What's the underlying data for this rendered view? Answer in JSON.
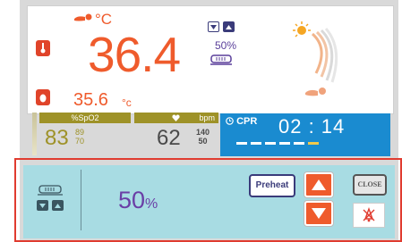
{
  "display": {
    "air_temp": "36.4",
    "air_temp_unit": "°C",
    "skin_temp": "35.6",
    "skin_temp_unit": "°c",
    "heater_top_pct": "50%"
  },
  "vitals": {
    "spo2_label": "%SpO2",
    "spo2_value": "83",
    "spo2_high": "89",
    "spo2_low": "70",
    "hr_unit": "bpm",
    "hr_value": "62",
    "hr_high": "140",
    "hr_low": "50"
  },
  "cpr": {
    "label": "CPR",
    "time": "02 : 14",
    "segments": [
      true,
      true,
      true,
      true,
      true,
      false
    ]
  },
  "panel": {
    "value": "50",
    "unit": "%",
    "preheat_label": "Preheat",
    "close_label": "CLOSE"
  },
  "colors": {
    "accent_orange": "#ef5b2c",
    "cpr_blue": "#1a8bd0",
    "panel_bg": "#a8dce3",
    "panel_border": "#e03c30",
    "purple": "#6a3ea6"
  }
}
